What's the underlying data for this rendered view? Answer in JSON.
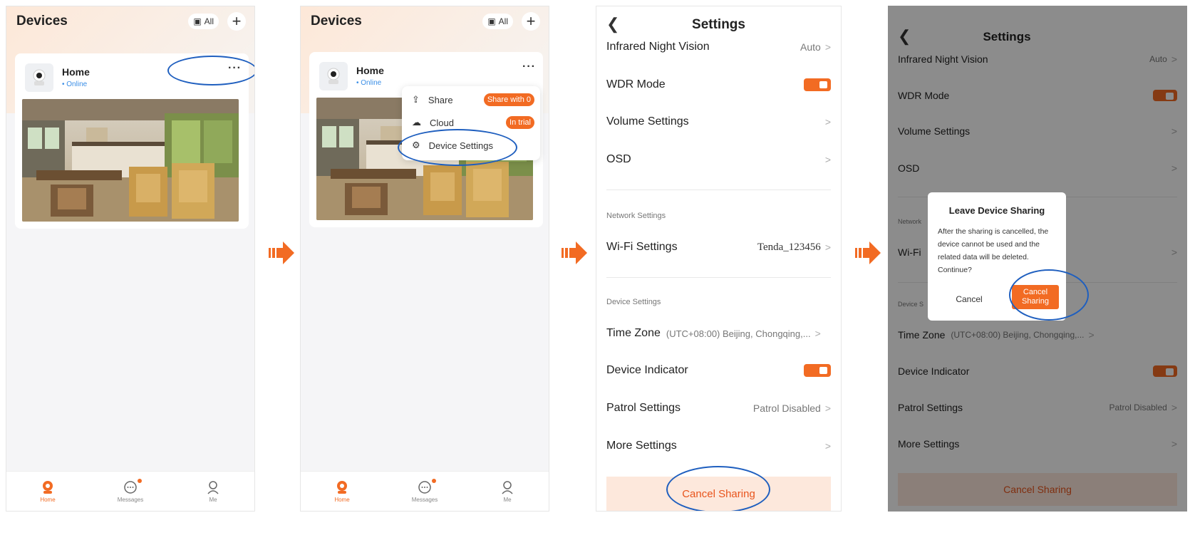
{
  "screen1": {
    "title": "Devices",
    "all_label": "All",
    "device": {
      "name": "Home",
      "status": "• Online",
      "more": "···"
    },
    "tabs": [
      {
        "label": "Home",
        "icon": "home-camera-icon"
      },
      {
        "label": "Messages",
        "icon": "messages-icon"
      },
      {
        "label": "Me",
        "icon": "me-icon"
      }
    ]
  },
  "screen2": {
    "title": "Devices",
    "all_label": "All",
    "device": {
      "name": "Home",
      "status": "• Online",
      "more": "···"
    },
    "menu": [
      {
        "label": "Share",
        "badge": "Share with 0",
        "icon": "share-icon"
      },
      {
        "label": "Cloud",
        "badge": "In trial",
        "icon": "cloud-icon"
      },
      {
        "label": "Device Settings",
        "icon": "gear-icon"
      }
    ],
    "tabs": [
      {
        "label": "Home"
      },
      {
        "label": "Messages"
      },
      {
        "label": "Me"
      }
    ]
  },
  "screen3": {
    "title": "Settings",
    "rows": {
      "infrared": {
        "label": "Infrared Night Vision",
        "value": "Auto"
      },
      "wdr": {
        "label": "WDR Mode"
      },
      "volume": {
        "label": "Volume Settings"
      },
      "osd": {
        "label": "OSD"
      },
      "network_section": "Network Settings",
      "wifi": {
        "label": "Wi-Fi Settings",
        "value": "Tenda_123456"
      },
      "device_section": "Device Settings",
      "timezone": {
        "label": "Time Zone",
        "value": "(UTC+08:00) Beijing, Chongqing,..."
      },
      "indicator": {
        "label": "Device Indicator"
      },
      "patrol": {
        "label": "Patrol Settings",
        "value": "Patrol Disabled"
      },
      "more": {
        "label": "More Settings"
      }
    },
    "cancel_sharing": "Cancel Sharing"
  },
  "screen4": {
    "title": "Settings",
    "rows": {
      "infrared": {
        "label": "Infrared Night Vision",
        "value": "Auto"
      },
      "wdr": {
        "label": "WDR Mode"
      },
      "volume": {
        "label": "Volume Settings"
      },
      "osd": {
        "label": "OSD"
      },
      "network_section": "Network",
      "wifi": {
        "label": "Wi-Fi"
      },
      "device_section": "Device S",
      "timezone": {
        "label": "Time Zone",
        "value": "(UTC+08:00) Beijing, Chongqing,..."
      },
      "indicator": {
        "label": "Device Indicator"
      },
      "patrol": {
        "label": "Patrol Settings",
        "value": "Patrol Disabled"
      },
      "more": {
        "label": "More Settings"
      }
    },
    "cancel_sharing": "Cancel Sharing",
    "dialog": {
      "title": "Leave Device Sharing",
      "body": "After the sharing is cancelled, the device cannot be used and the related data will be deleted. Continue?",
      "cancel": "Cancel",
      "confirm": "Cancel Sharing"
    }
  },
  "colors": {
    "accent": "#f26b23",
    "highlight_ring": "#1f5fbf",
    "online": "#3a8ee6"
  }
}
